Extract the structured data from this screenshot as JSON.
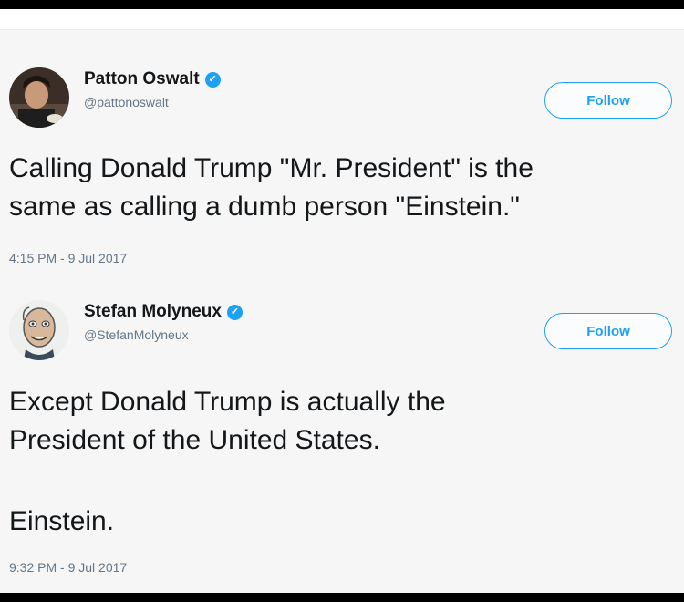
{
  "tweets": [
    {
      "name": "Patton Oswalt",
      "handle": "@pattonoswalt",
      "follow_label": "Follow",
      "text_lines": [
        "Calling Donald Trump \"Mr. President\" is the",
        "same as calling a dumb person \"Einstein.\""
      ],
      "timestamp": "4:15 PM - 9 Jul 2017"
    },
    {
      "name": "Stefan Molyneux",
      "handle": "@StefanMolyneux",
      "follow_label": "Follow",
      "text_lines": [
        "Except Donald Trump is actually the",
        "President of the United States.",
        "Einstein."
      ],
      "timestamp": "9:32 PM - 9 Jul 2017"
    }
  ],
  "colors": {
    "accent": "#1da1f2",
    "text": "#14171a",
    "secondary": "#657786"
  },
  "icons": [
    "verified-badge-icon",
    "avatar"
  ]
}
